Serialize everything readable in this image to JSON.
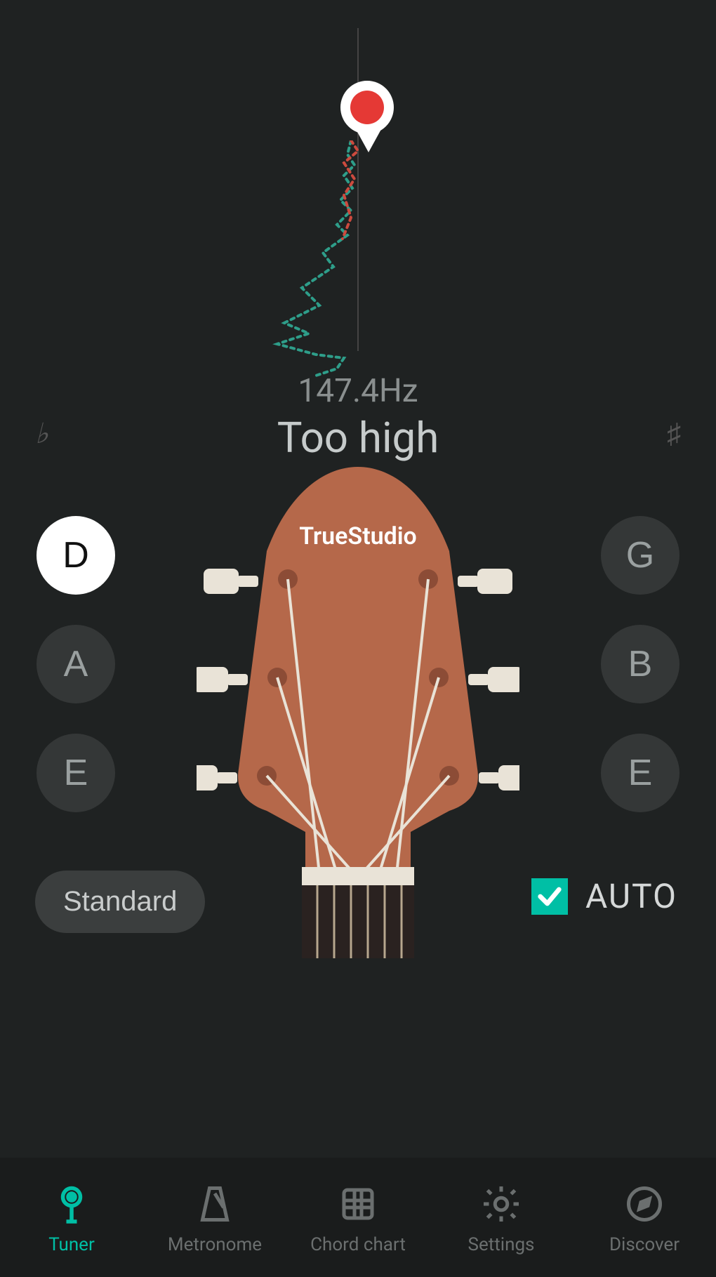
{
  "tuner": {
    "frequency": "147.4Hz",
    "status": "Too high",
    "flat_symbol": "♭",
    "sharp_symbol": "♯",
    "brand": "TrueStudio"
  },
  "pegs": {
    "left": [
      "D",
      "A",
      "E"
    ],
    "right": [
      "G",
      "B",
      "E"
    ],
    "active_index": 0,
    "active_side": "left"
  },
  "tuning": {
    "mode": "Standard",
    "auto_label": "AUTO",
    "auto_checked": true
  },
  "nav": {
    "items": [
      {
        "label": "Tuner",
        "icon": "tuner"
      },
      {
        "label": "Metronome",
        "icon": "metronome"
      },
      {
        "label": "Chord chart",
        "icon": "chord"
      },
      {
        "label": "Settings",
        "icon": "settings"
      },
      {
        "label": "Discover",
        "icon": "discover"
      }
    ],
    "active": 0
  },
  "colors": {
    "accent": "#00bfa5",
    "bg": "#1f2222",
    "indicator": "#e53935"
  }
}
